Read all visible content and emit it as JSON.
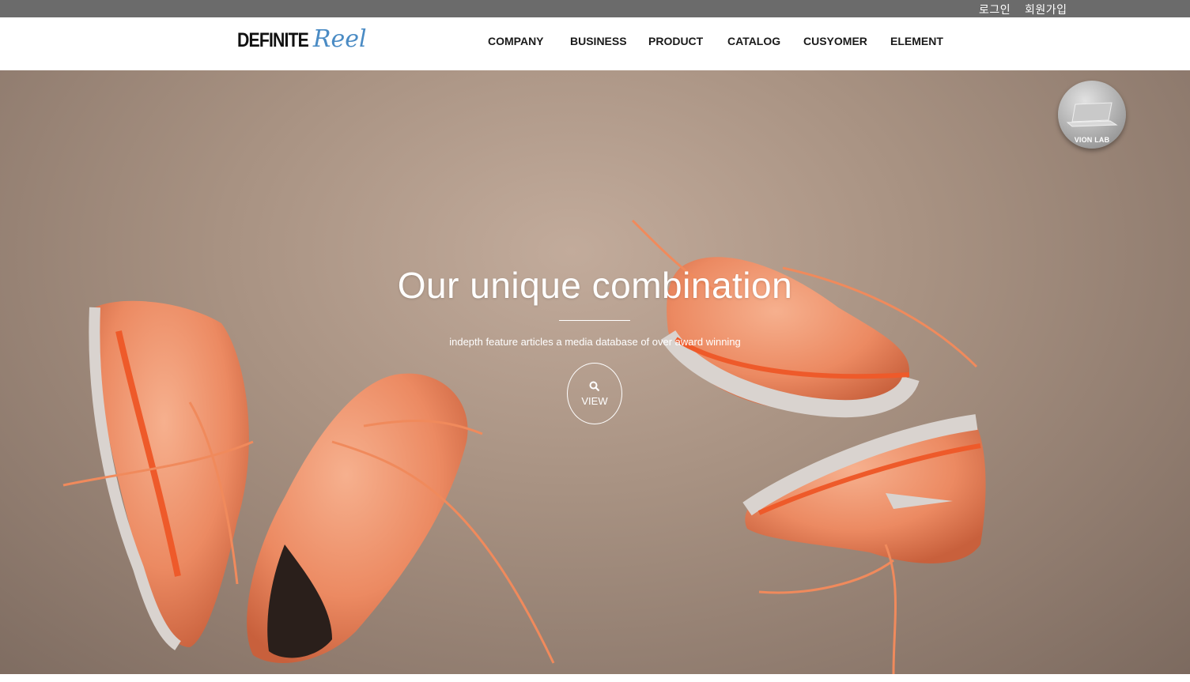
{
  "topbar": {
    "login": "로그인",
    "signup": "회원가입"
  },
  "header": {
    "logo_main": "DEFINITE",
    "logo_script": "Reel",
    "nav": [
      "COMPANY",
      "BUSINESS",
      "PRODUCT",
      "CATALOG",
      "CUSYOMER",
      "ELEMENT"
    ]
  },
  "badge": {
    "label": "VION LAB",
    "icon": "laptop-icon"
  },
  "hero": {
    "title": "Our unique combination",
    "subtitle": "indepth feature articles a media database of over award winning",
    "button_label": "VIEW",
    "button_icon": "search-icon",
    "image": "orange-running-shoes-photo",
    "colors": {
      "background": "#a89282",
      "shoe": "#f0926a",
      "accent": "#ee5a2a"
    }
  },
  "colors": {
    "topbar": "#6b6b6b",
    "logo_script": "#4a8bc4",
    "nav_text": "#1a1a1a"
  }
}
